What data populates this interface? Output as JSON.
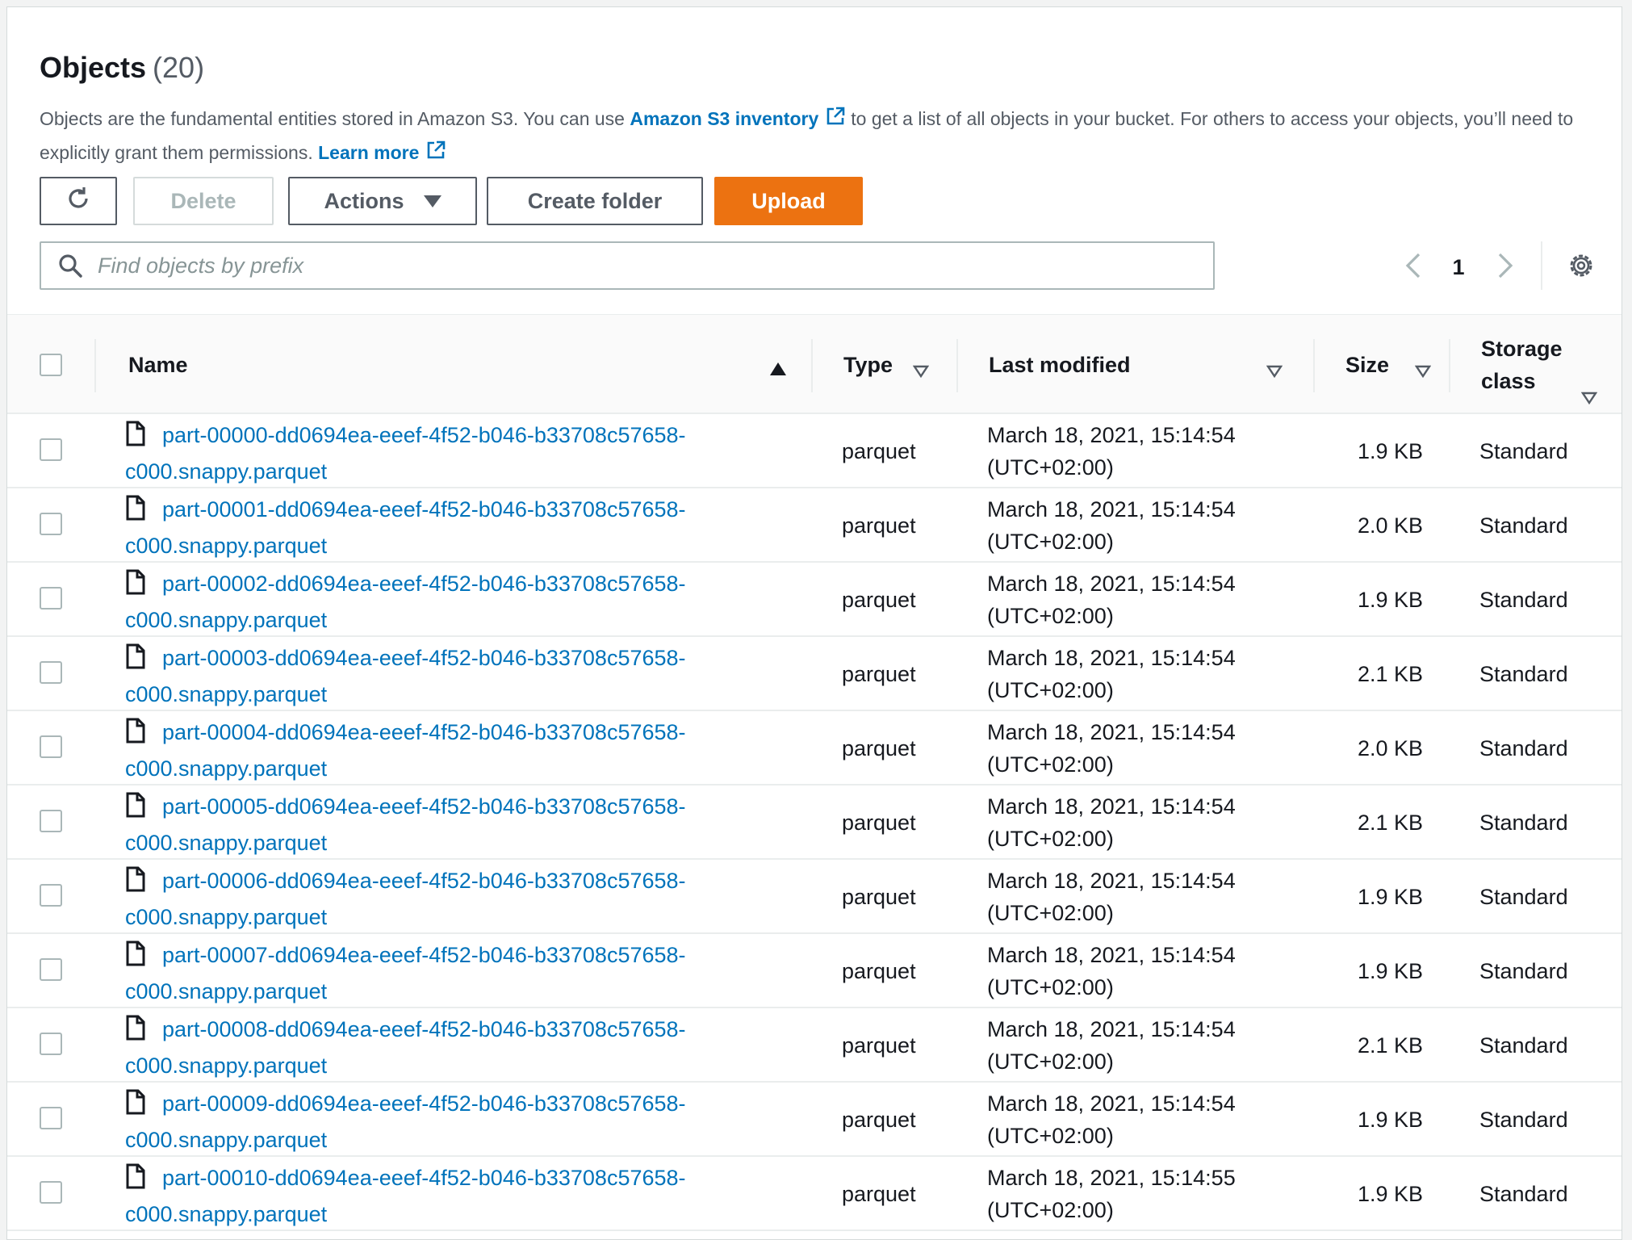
{
  "header": {
    "title": "Objects",
    "count": "(20)",
    "description_pre": "Objects are the fundamental entities stored in Amazon S3. You can use ",
    "inventory_link": "Amazon S3 inventory",
    "description_mid": "to get a list of all objects in your bucket. For others to access your objects, you’ll need to explicitly grant them permissions. ",
    "learn_more": "Learn more"
  },
  "toolbar": {
    "delete_label": "Delete",
    "actions_label": "Actions",
    "create_folder_label": "Create folder",
    "upload_label": "Upload"
  },
  "search": {
    "placeholder": "Find objects by prefix",
    "value": ""
  },
  "pagination": {
    "current_page": "1"
  },
  "colors": {
    "accent": "#ec7211",
    "link": "#0073bb",
    "text": "#16191f",
    "muted": "#545b64",
    "border": "#eaeded"
  },
  "table": {
    "columns": {
      "name": "Name",
      "type": "Type",
      "last_modified": "Last modified",
      "size": "Size",
      "storage_class_line1": "Storage",
      "storage_class_line2": "class"
    },
    "rows": [
      {
        "name_line1": "part-00000-dd0694ea-eeef-4f52-b046-b33708c57658-",
        "name_line2": "c000.snappy.parquet",
        "type": "parquet",
        "modified_line1": "March 18, 2021, 15:14:54",
        "modified_line2": "(UTC+02:00)",
        "size": "1.9 KB",
        "storage": "Standard"
      },
      {
        "name_line1": "part-00001-dd0694ea-eeef-4f52-b046-b33708c57658-",
        "name_line2": "c000.snappy.parquet",
        "type": "parquet",
        "modified_line1": "March 18, 2021, 15:14:54",
        "modified_line2": "(UTC+02:00)",
        "size": "2.0 KB",
        "storage": "Standard"
      },
      {
        "name_line1": "part-00002-dd0694ea-eeef-4f52-b046-b33708c57658-",
        "name_line2": "c000.snappy.parquet",
        "type": "parquet",
        "modified_line1": "March 18, 2021, 15:14:54",
        "modified_line2": "(UTC+02:00)",
        "size": "1.9 KB",
        "storage": "Standard"
      },
      {
        "name_line1": "part-00003-dd0694ea-eeef-4f52-b046-b33708c57658-",
        "name_line2": "c000.snappy.parquet",
        "type": "parquet",
        "modified_line1": "March 18, 2021, 15:14:54",
        "modified_line2": "(UTC+02:00)",
        "size": "2.1 KB",
        "storage": "Standard"
      },
      {
        "name_line1": "part-00004-dd0694ea-eeef-4f52-b046-b33708c57658-",
        "name_line2": "c000.snappy.parquet",
        "type": "parquet",
        "modified_line1": "March 18, 2021, 15:14:54",
        "modified_line2": "(UTC+02:00)",
        "size": "2.0 KB",
        "storage": "Standard"
      },
      {
        "name_line1": "part-00005-dd0694ea-eeef-4f52-b046-b33708c57658-",
        "name_line2": "c000.snappy.parquet",
        "type": "parquet",
        "modified_line1": "March 18, 2021, 15:14:54",
        "modified_line2": "(UTC+02:00)",
        "size": "2.1 KB",
        "storage": "Standard"
      },
      {
        "name_line1": "part-00006-dd0694ea-eeef-4f52-b046-b33708c57658-",
        "name_line2": "c000.snappy.parquet",
        "type": "parquet",
        "modified_line1": "March 18, 2021, 15:14:54",
        "modified_line2": "(UTC+02:00)",
        "size": "1.9 KB",
        "storage": "Standard"
      },
      {
        "name_line1": "part-00007-dd0694ea-eeef-4f52-b046-b33708c57658-",
        "name_line2": "c000.snappy.parquet",
        "type": "parquet",
        "modified_line1": "March 18, 2021, 15:14:54",
        "modified_line2": "(UTC+02:00)",
        "size": "1.9 KB",
        "storage": "Standard"
      },
      {
        "name_line1": "part-00008-dd0694ea-eeef-4f52-b046-b33708c57658-",
        "name_line2": "c000.snappy.parquet",
        "type": "parquet",
        "modified_line1": "March 18, 2021, 15:14:54",
        "modified_line2": "(UTC+02:00)",
        "size": "2.1 KB",
        "storage": "Standard"
      },
      {
        "name_line1": "part-00009-dd0694ea-eeef-4f52-b046-b33708c57658-",
        "name_line2": "c000.snappy.parquet",
        "type": "parquet",
        "modified_line1": "March 18, 2021, 15:14:54",
        "modified_line2": "(UTC+02:00)",
        "size": "1.9 KB",
        "storage": "Standard"
      },
      {
        "name_line1": "part-00010-dd0694ea-eeef-4f52-b046-b33708c57658-",
        "name_line2": "c000.snappy.parquet",
        "type": "parquet",
        "modified_line1": "March 18, 2021, 15:14:55",
        "modified_line2": "(UTC+02:00)",
        "size": "1.9 KB",
        "storage": "Standard"
      }
    ]
  }
}
